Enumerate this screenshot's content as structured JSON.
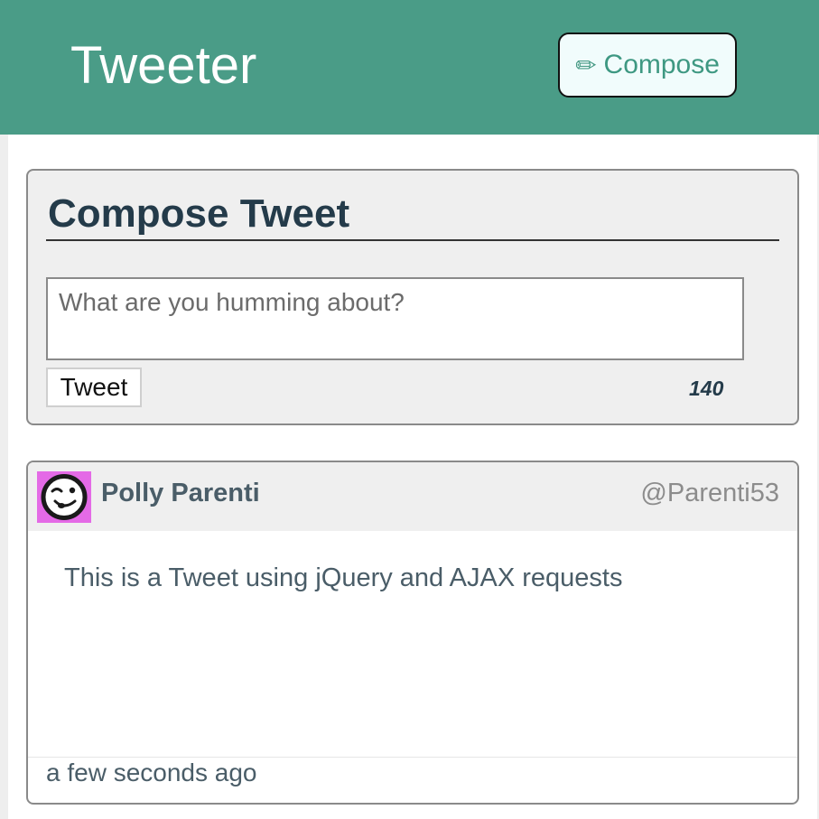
{
  "navbar": {
    "brand": "Tweeter",
    "compose_icon": "pencil-icon",
    "compose_label": "Compose",
    "background_color": "#4a9c87"
  },
  "compose": {
    "title": "Compose Tweet",
    "placeholder": "What are you humming about?",
    "value": "",
    "submit_label": "Tweet",
    "char_count": "140"
  },
  "tweet": {
    "avatar_icon": "winking-face-icon",
    "name": "Polly Parenti",
    "handle": "@Parenti53",
    "text": "This is a Tweet using jQuery and AJAX requests",
    "timestamp": "a few seconds ago"
  }
}
